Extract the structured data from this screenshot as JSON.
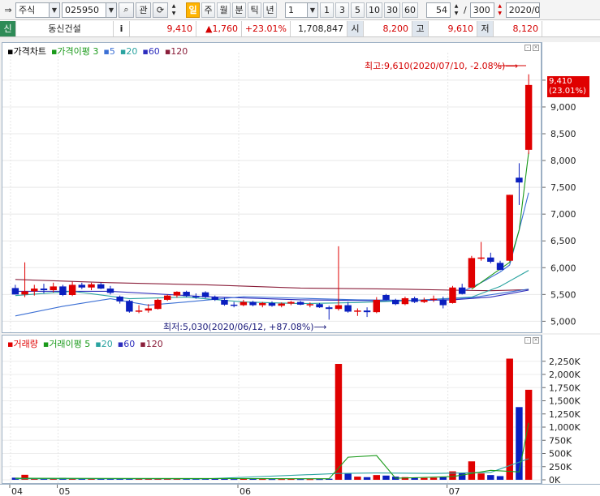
{
  "toolbar": {
    "market_select": "주식",
    "code_input": "025950",
    "btn_search": "⌕",
    "btn_gwan": "관",
    "btn_refresh": "⟳",
    "periods": [
      "일",
      "주",
      "월",
      "분",
      "틱",
      "년"
    ],
    "period_active": "일",
    "interval_select": "1",
    "interval_buttons": [
      "1",
      "3",
      "5",
      "10",
      "30",
      "60"
    ],
    "view_count": "54",
    "slash": "/",
    "total_count": "300",
    "date_field": "2020/0"
  },
  "quote": {
    "type_badge": "신",
    "name": "동신건설",
    "info_icon": "i",
    "price": "9,410",
    "change": "▲1,760",
    "change_pct": "+23.01%",
    "volume": "1,708,847",
    "open_label": "시",
    "open": "8,200",
    "high_label": "고",
    "high": "9,610",
    "low_label": "저",
    "low": "8,120"
  },
  "price_panel": {
    "legend": {
      "title": "가격차트",
      "ma_label": "가격이평",
      "periods": [
        "3",
        "5",
        "20",
        "60",
        "120"
      ]
    },
    "high_annotation": "최고:9,610(2020/07/10, -2.08%)⟶",
    "low_annotation": "최저:5,030(2020/06/12, +87.08%)⟶",
    "current_price_tag": "9,410",
    "current_pct_tag": "(23.01%)"
  },
  "volume_panel": {
    "legend": {
      "title": "거래량",
      "ma_label": "거래이평",
      "periods": [
        "5",
        "20",
        "60",
        "120"
      ]
    }
  },
  "colors": {
    "up": "#e00000",
    "down": "#0a1fbf",
    "ma3": "#1a9a1a",
    "ma5": "#3b6fd4",
    "ma20": "#2aa3a0",
    "ma60": "#2c2cbd",
    "ma120": "#8a1e3a"
  },
  "chart_data": {
    "type": "candlestick",
    "price_axis": {
      "ticks": [
        "9,500",
        "9,000",
        "8,500",
        "8,000",
        "7,500",
        "7,000",
        "6,500",
        "6,000",
        "5,500",
        "5,000"
      ],
      "ylim": [
        4900,
        9650
      ]
    },
    "volume_axis": {
      "ticks": [
        "2,250K",
        "2,000K",
        "1,750K",
        "1,500K",
        "1,250K",
        "1,000K",
        "750K",
        "500K",
        "250K",
        "0K"
      ],
      "ylim": [
        0,
        2400000
      ]
    },
    "x_labels": [
      {
        "label": "04",
        "index": 0
      },
      {
        "label": "05",
        "index": 5
      },
      {
        "label": "06",
        "index": 24
      },
      {
        "label": "07",
        "index": 46
      }
    ],
    "candles": [
      {
        "o": 5620,
        "h": 5680,
        "l": 5500,
        "c": 5500,
        "v": 40000
      },
      {
        "o": 5500,
        "h": 6100,
        "l": 5450,
        "c": 5560,
        "v": 95000
      },
      {
        "o": 5560,
        "h": 5680,
        "l": 5480,
        "c": 5610,
        "v": 30000
      },
      {
        "o": 5610,
        "h": 5700,
        "l": 5520,
        "c": 5580,
        "v": 25000
      },
      {
        "o": 5580,
        "h": 5720,
        "l": 5540,
        "c": 5650,
        "v": 30000
      },
      {
        "o": 5650,
        "h": 5680,
        "l": 5470,
        "c": 5490,
        "v": 35000
      },
      {
        "o": 5490,
        "h": 5740,
        "l": 5470,
        "c": 5680,
        "v": 30000
      },
      {
        "o": 5680,
        "h": 5720,
        "l": 5600,
        "c": 5630,
        "v": 25000
      },
      {
        "o": 5630,
        "h": 5720,
        "l": 5580,
        "c": 5690,
        "v": 20000
      },
      {
        "o": 5690,
        "h": 5720,
        "l": 5600,
        "c": 5610,
        "v": 25000
      },
      {
        "o": 5610,
        "h": 5660,
        "l": 5500,
        "c": 5530,
        "v": 20000
      },
      {
        "o": 5460,
        "h": 5480,
        "l": 5330,
        "c": 5370,
        "v": 20000
      },
      {
        "o": 5380,
        "h": 5400,
        "l": 5160,
        "c": 5180,
        "v": 22000
      },
      {
        "o": 5180,
        "h": 5300,
        "l": 5150,
        "c": 5200,
        "v": 20000
      },
      {
        "o": 5200,
        "h": 5320,
        "l": 5160,
        "c": 5240,
        "v": 18000
      },
      {
        "o": 5230,
        "h": 5420,
        "l": 5220,
        "c": 5400,
        "v": 20000
      },
      {
        "o": 5400,
        "h": 5500,
        "l": 5380,
        "c": 5480,
        "v": 22000
      },
      {
        "o": 5480,
        "h": 5560,
        "l": 5440,
        "c": 5550,
        "v": 20000
      },
      {
        "o": 5550,
        "h": 5570,
        "l": 5450,
        "c": 5470,
        "v": 18000
      },
      {
        "o": 5470,
        "h": 5520,
        "l": 5420,
        "c": 5460,
        "v": 16000
      },
      {
        "o": 5540,
        "h": 5560,
        "l": 5430,
        "c": 5450,
        "v": 18000
      },
      {
        "o": 5450,
        "h": 5480,
        "l": 5380,
        "c": 5400,
        "v": 16000
      },
      {
        "o": 5400,
        "h": 5440,
        "l": 5290,
        "c": 5310,
        "v": 15000
      },
      {
        "o": 5310,
        "h": 5360,
        "l": 5260,
        "c": 5300,
        "v": 14000
      },
      {
        "o": 5300,
        "h": 5400,
        "l": 5280,
        "c": 5360,
        "v": 16000
      },
      {
        "o": 5360,
        "h": 5380,
        "l": 5280,
        "c": 5300,
        "v": 15000
      },
      {
        "o": 5300,
        "h": 5360,
        "l": 5260,
        "c": 5340,
        "v": 14000
      },
      {
        "o": 5340,
        "h": 5370,
        "l": 5270,
        "c": 5290,
        "v": 13000
      },
      {
        "o": 5290,
        "h": 5350,
        "l": 5260,
        "c": 5330,
        "v": 13000
      },
      {
        "o": 5330,
        "h": 5380,
        "l": 5300,
        "c": 5360,
        "v": 14000
      },
      {
        "o": 5360,
        "h": 5380,
        "l": 5300,
        "c": 5310,
        "v": 13000
      },
      {
        "o": 5310,
        "h": 5350,
        "l": 5260,
        "c": 5320,
        "v": 12000
      },
      {
        "o": 5320,
        "h": 5340,
        "l": 5250,
        "c": 5260,
        "v": 13000
      },
      {
        "o": 5260,
        "h": 5290,
        "l": 5030,
        "c": 5230,
        "v": 20000
      },
      {
        "o": 5230,
        "h": 6400,
        "l": 5200,
        "c": 5300,
        "v": 2200000
      },
      {
        "o": 5300,
        "h": 5360,
        "l": 5160,
        "c": 5180,
        "v": 120000
      },
      {
        "o": 5180,
        "h": 5240,
        "l": 5100,
        "c": 5200,
        "v": 60000
      },
      {
        "o": 5200,
        "h": 5260,
        "l": 5080,
        "c": 5170,
        "v": 50000
      },
      {
        "o": 5170,
        "h": 5450,
        "l": 5150,
        "c": 5400,
        "v": 90000
      },
      {
        "o": 5490,
        "h": 5510,
        "l": 5390,
        "c": 5400,
        "v": 80000
      },
      {
        "o": 5400,
        "h": 5420,
        "l": 5300,
        "c": 5320,
        "v": 60000
      },
      {
        "o": 5320,
        "h": 5460,
        "l": 5300,
        "c": 5430,
        "v": 50000
      },
      {
        "o": 5430,
        "h": 5460,
        "l": 5340,
        "c": 5360,
        "v": 40000
      },
      {
        "o": 5360,
        "h": 5440,
        "l": 5340,
        "c": 5400,
        "v": 35000
      },
      {
        "o": 5400,
        "h": 5480,
        "l": 5360,
        "c": 5420,
        "v": 40000
      },
      {
        "o": 5400,
        "h": 5460,
        "l": 5240,
        "c": 5300,
        "v": 50000
      },
      {
        "o": 5340,
        "h": 5660,
        "l": 5330,
        "c": 5630,
        "v": 160000
      },
      {
        "o": 5630,
        "h": 5700,
        "l": 5500,
        "c": 5510,
        "v": 130000
      },
      {
        "o": 5630,
        "h": 6220,
        "l": 5620,
        "c": 6180,
        "v": 350000
      },
      {
        "o": 6180,
        "h": 6480,
        "l": 6130,
        "c": 6190,
        "v": 120000
      },
      {
        "o": 6190,
        "h": 6280,
        "l": 6080,
        "c": 6110,
        "v": 90000
      },
      {
        "o": 6090,
        "h": 6130,
        "l": 5950,
        "c": 5960,
        "v": 70000
      },
      {
        "o": 6130,
        "h": 7360,
        "l": 6120,
        "c": 7360,
        "v": 2300000
      },
      {
        "o": 7680,
        "h": 7950,
        "l": 7170,
        "c": 7590,
        "v": 1380000
      },
      {
        "o": 8200,
        "h": 9610,
        "l": 8120,
        "c": 9410,
        "v": 1708847
      }
    ],
    "ma_lines": {
      "ma3": [
        [
          48,
          5600
        ],
        [
          50,
          5850
        ],
        [
          52,
          6100
        ],
        [
          53,
          6700
        ],
        [
          54,
          8150
        ]
      ],
      "ma5": [
        [
          47,
          5550
        ],
        [
          49,
          5720
        ],
        [
          51,
          5920
        ],
        [
          52,
          6050
        ],
        [
          53,
          6700
        ],
        [
          54,
          7400
        ]
      ],
      "ma20": [
        [
          0,
          5480
        ],
        [
          6,
          5560
        ],
        [
          12,
          5420
        ],
        [
          18,
          5450
        ],
        [
          24,
          5360
        ],
        [
          30,
          5330
        ],
        [
          36,
          5350
        ],
        [
          42,
          5390
        ],
        [
          48,
          5450
        ],
        [
          51,
          5650
        ],
        [
          54,
          5950
        ]
      ],
      "ma60": [
        [
          0,
          5560
        ],
        [
          10,
          5560
        ],
        [
          20,
          5460
        ],
        [
          30,
          5400
        ],
        [
          40,
          5380
        ],
        [
          46,
          5400
        ],
        [
          50,
          5450
        ],
        [
          54,
          5580
        ]
      ],
      "ma120": [
        [
          0,
          5780
        ],
        [
          10,
          5720
        ],
        [
          20,
          5680
        ],
        [
          30,
          5620
        ],
        [
          40,
          5600
        ],
        [
          46,
          5580
        ],
        [
          50,
          5570
        ],
        [
          54,
          5590
        ]
      ],
      "ma_baseline": [
        [
          0,
          5100
        ],
        [
          5,
          5280
        ],
        [
          10,
          5420
        ],
        [
          14,
          5300
        ],
        [
          18,
          5360
        ],
        [
          24,
          5460
        ],
        [
          30,
          5430
        ],
        [
          36,
          5400
        ],
        [
          42,
          5390
        ],
        [
          48,
          5440
        ],
        [
          54,
          5600
        ]
      ],
      "vol_ma5": [
        [
          0,
          30000
        ],
        [
          20,
          25000
        ],
        [
          33,
          20000
        ],
        [
          35,
          430000
        ],
        [
          38,
          460000
        ],
        [
          40,
          30000
        ],
        [
          46,
          60000
        ],
        [
          50,
          180000
        ],
        [
          53,
          150000
        ],
        [
          54,
          1080000
        ]
      ],
      "vol_ma20": [
        [
          0,
          20000
        ],
        [
          20,
          18000
        ],
        [
          34,
          120000
        ],
        [
          38,
          130000
        ],
        [
          44,
          120000
        ],
        [
          50,
          140000
        ],
        [
          54,
          400000
        ]
      ]
    }
  }
}
